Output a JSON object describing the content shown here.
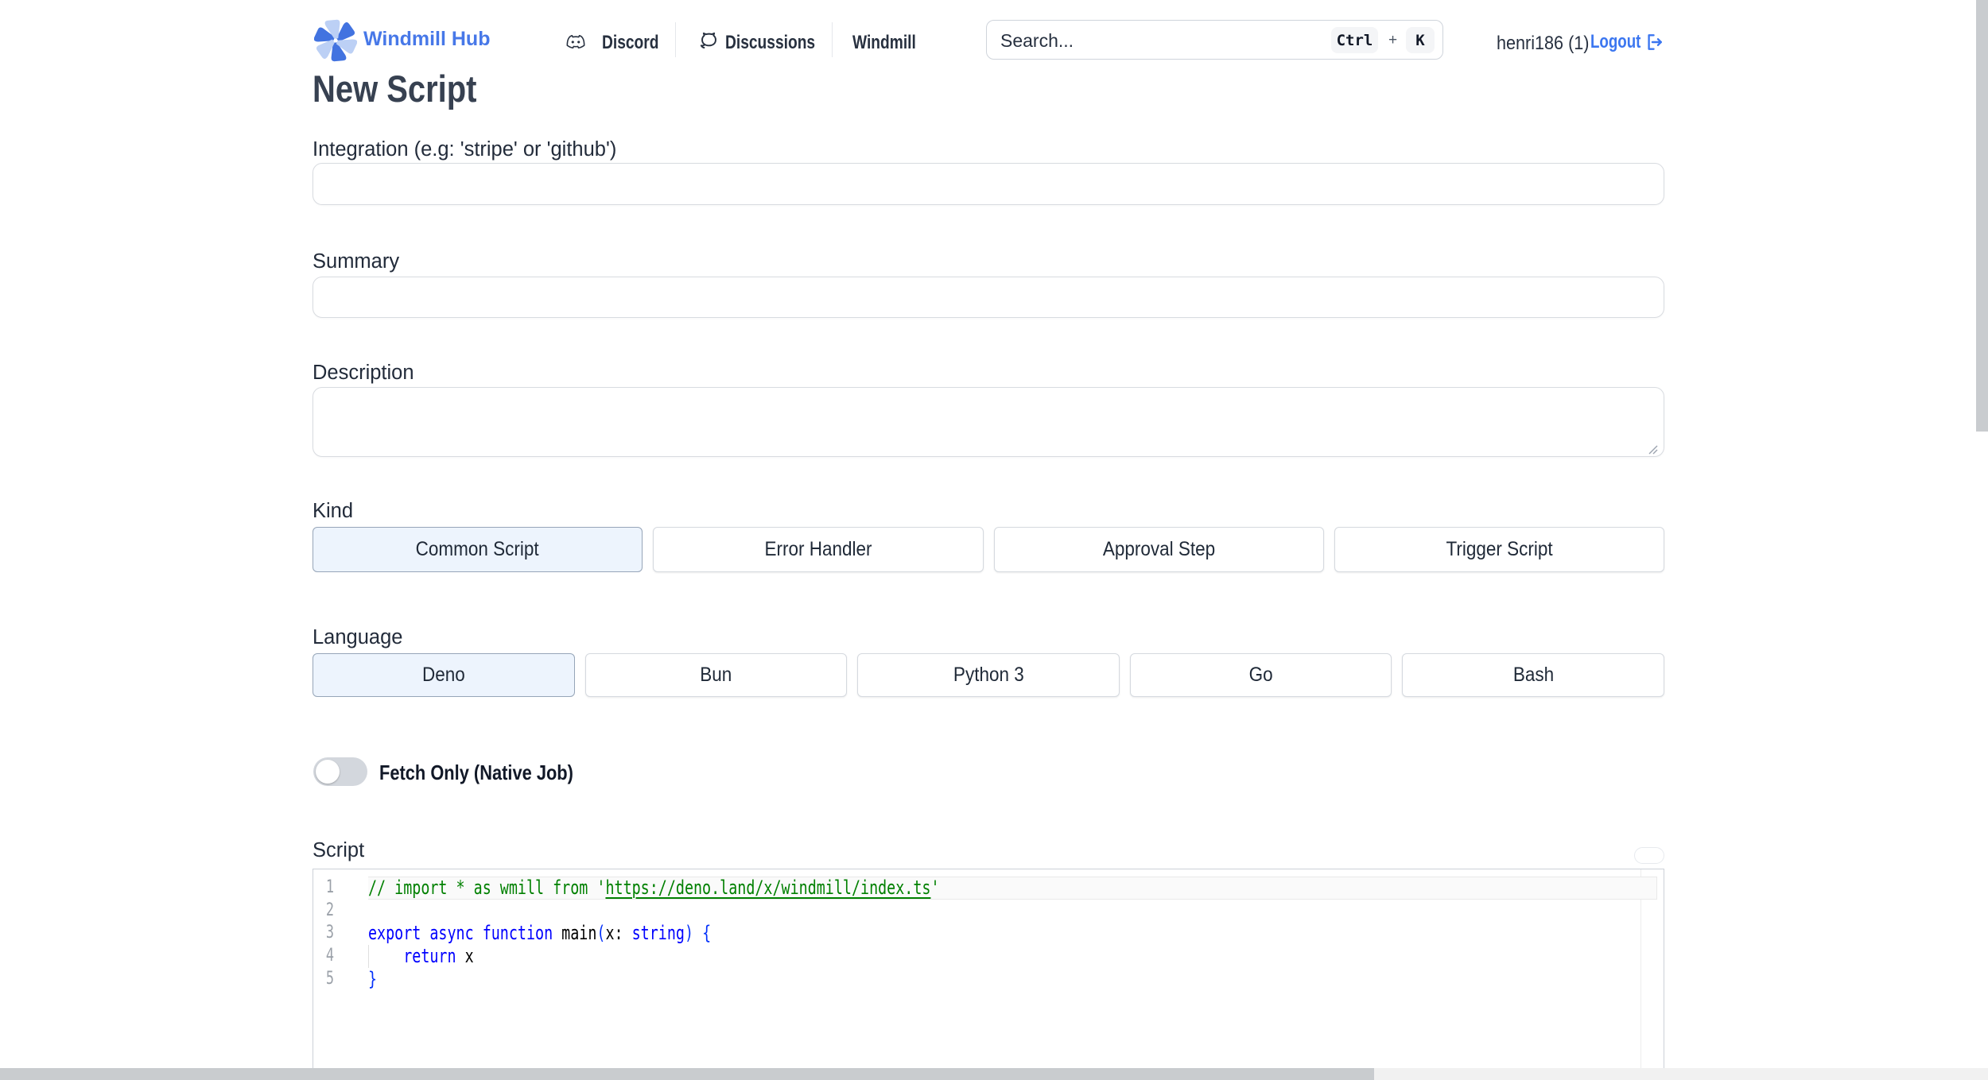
{
  "header": {
    "brand": "Windmill Hub",
    "nav": [
      {
        "label": "Discord",
        "icon": "discord-icon"
      },
      {
        "label": "Discussions",
        "icon": "discussions-icon"
      },
      {
        "label": "Windmill"
      }
    ],
    "search": {
      "placeholder": "Search...",
      "shortcut_keys": [
        "Ctrl",
        "K"
      ],
      "shortcut_separator": "+"
    },
    "user": {
      "name": "henri186 (1)",
      "logout_label": "Logout"
    }
  },
  "page": {
    "title": "New Script"
  },
  "form": {
    "integration": {
      "label": "Integration (e.g: 'stripe' or 'github')",
      "value": ""
    },
    "summary": {
      "label": "Summary",
      "value": ""
    },
    "description": {
      "label": "Description",
      "value": ""
    },
    "kind": {
      "label": "Kind",
      "options": [
        "Common Script",
        "Error Handler",
        "Approval Step",
        "Trigger Script"
      ],
      "selected": "Common Script"
    },
    "language": {
      "label": "Language",
      "options": [
        "Deno",
        "Bun",
        "Python 3",
        "Go",
        "Bash"
      ],
      "selected": "Deno"
    },
    "fetch_only": {
      "label": "Fetch Only (Native Job)",
      "enabled": false
    },
    "script": {
      "label": "Script"
    }
  },
  "editor": {
    "line_numbers": [
      "1",
      "2",
      "3",
      "4",
      "5"
    ],
    "lines": [
      [
        [
          "// import * as wmill from '",
          "comment"
        ],
        [
          "https://deno.land/x/windmill/index.ts",
          "comment link"
        ],
        [
          "'",
          "comment"
        ]
      ],
      [],
      [
        [
          "export async function ",
          "keyword"
        ],
        [
          "main",
          "default"
        ],
        [
          "(",
          "bracket"
        ],
        [
          "x: ",
          "default"
        ],
        [
          "string",
          "keyword"
        ],
        [
          ")",
          "bracket"
        ],
        [
          " ",
          "default"
        ],
        [
          "{",
          "bracket"
        ]
      ],
      [
        [
          "    ",
          "default"
        ],
        [
          "return",
          "keyword"
        ],
        [
          " x",
          "default"
        ]
      ],
      [
        [
          "}",
          "bracket"
        ]
      ]
    ],
    "colors": {
      "comment": "#008000",
      "keyword": "#0000ff",
      "bracket": "#0431fa",
      "default": "#000000",
      "line_number": "#9aa0a8"
    }
  },
  "colors": {
    "accent_blue": "#4778e8",
    "link_blue": "#3b76f0",
    "selected_bg": "#edf4fd"
  }
}
